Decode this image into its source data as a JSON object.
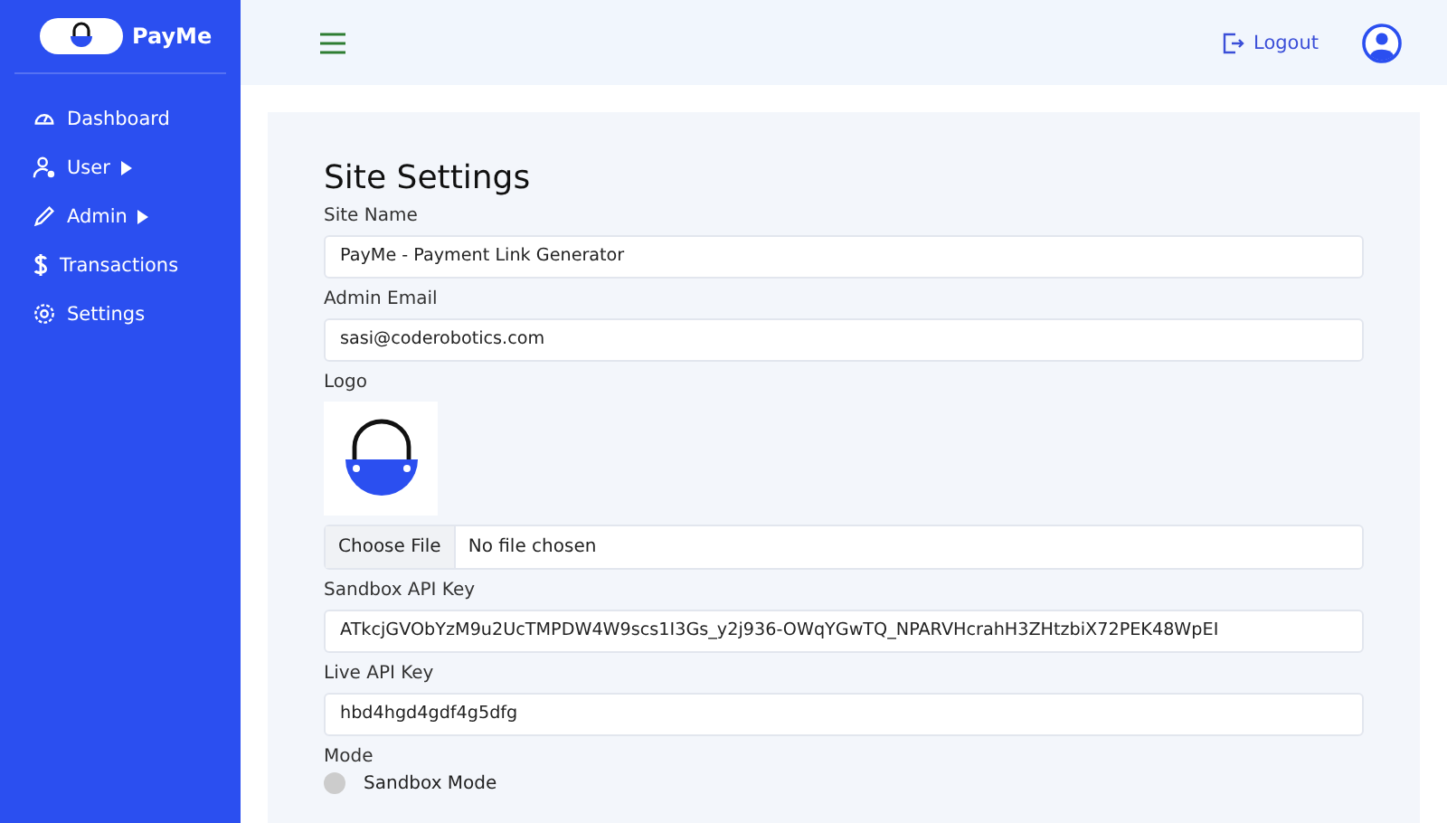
{
  "brand": {
    "name": "PayMe"
  },
  "sidebar": {
    "items": [
      {
        "label": "Dashboard",
        "has_submenu": false
      },
      {
        "label": "User",
        "has_submenu": true
      },
      {
        "label": "Admin",
        "has_submenu": true
      },
      {
        "label": "Transactions",
        "has_submenu": false
      },
      {
        "label": "Settings",
        "has_submenu": false
      }
    ]
  },
  "header": {
    "logout": "Logout"
  },
  "form": {
    "title": "Site Settings",
    "fields": [
      {
        "kind": "text",
        "label": "Site Name",
        "value": "PayMe - Payment Link Generator"
      },
      {
        "kind": "text",
        "label": "Admin Email",
        "value": "sasi@coderobotics.com"
      },
      {
        "kind": "logo",
        "label": "Logo",
        "button": "Choose File",
        "status": "No file chosen"
      },
      {
        "kind": "text",
        "label": "Sandbox API Key",
        "value": "ATkcjGVObYzM9u2UcTMPDW4W9scs1I3Gs_y2j936-OWqYGwTQ_NPARVHcrahH3ZHtzbiX72PEK48WpEI"
      },
      {
        "kind": "text",
        "label": "Live API Key",
        "value": "hbd4hgd4gdf4g5dfg"
      },
      {
        "kind": "radio",
        "label": "Mode",
        "options": [
          {
            "label": "Sandbox Mode",
            "selected": false
          }
        ]
      }
    ]
  }
}
